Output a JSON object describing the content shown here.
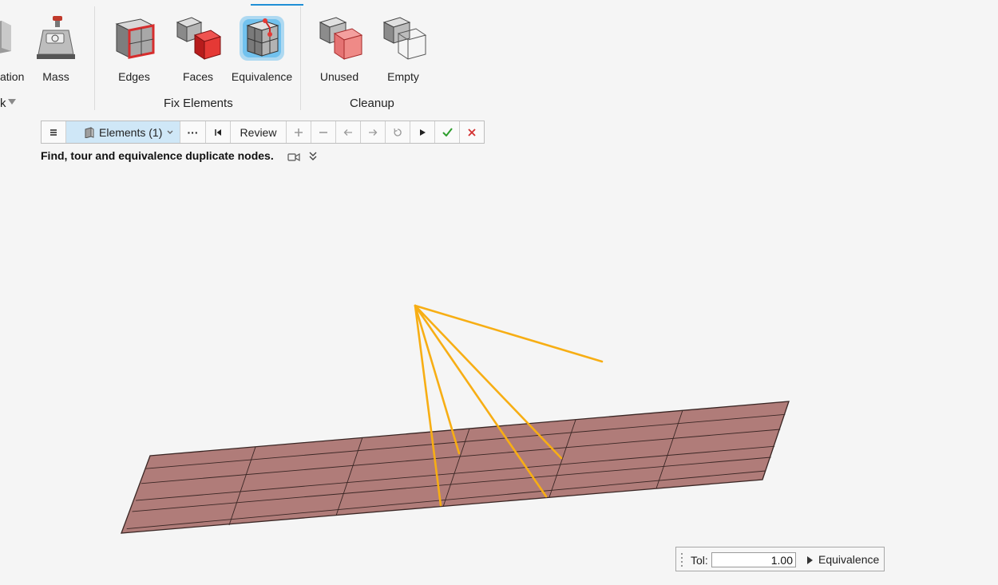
{
  "ribbon": {
    "partial_left_label": "ation",
    "partial_group_label": "k",
    "tools": [
      {
        "label": "Mass"
      },
      {
        "label": "Edges"
      },
      {
        "label": "Faces"
      },
      {
        "label": "Equivalence",
        "active": true
      },
      {
        "label": "Unused"
      },
      {
        "label": "Empty"
      }
    ],
    "groups": [
      {
        "label": "Fix Elements"
      },
      {
        "label": "Cleanup"
      }
    ]
  },
  "toolbar": {
    "menu_icon": "hamburger-icon",
    "selector_label": "Elements (1)",
    "more_label": "···",
    "review_label": "Review"
  },
  "description": "Find, tour and equivalence duplicate nodes.",
  "tolerance": {
    "label": "Tol:",
    "value": "1.00",
    "action_label": "Equivalence"
  },
  "colors": {
    "mesh_fill": "#b07c79",
    "mesh_edge": "#3a2624",
    "highlight_lines": "#f7ae14",
    "active_glow": "#2aa7ea",
    "accept": "#2e9e2e",
    "reject": "#d32f2f"
  }
}
